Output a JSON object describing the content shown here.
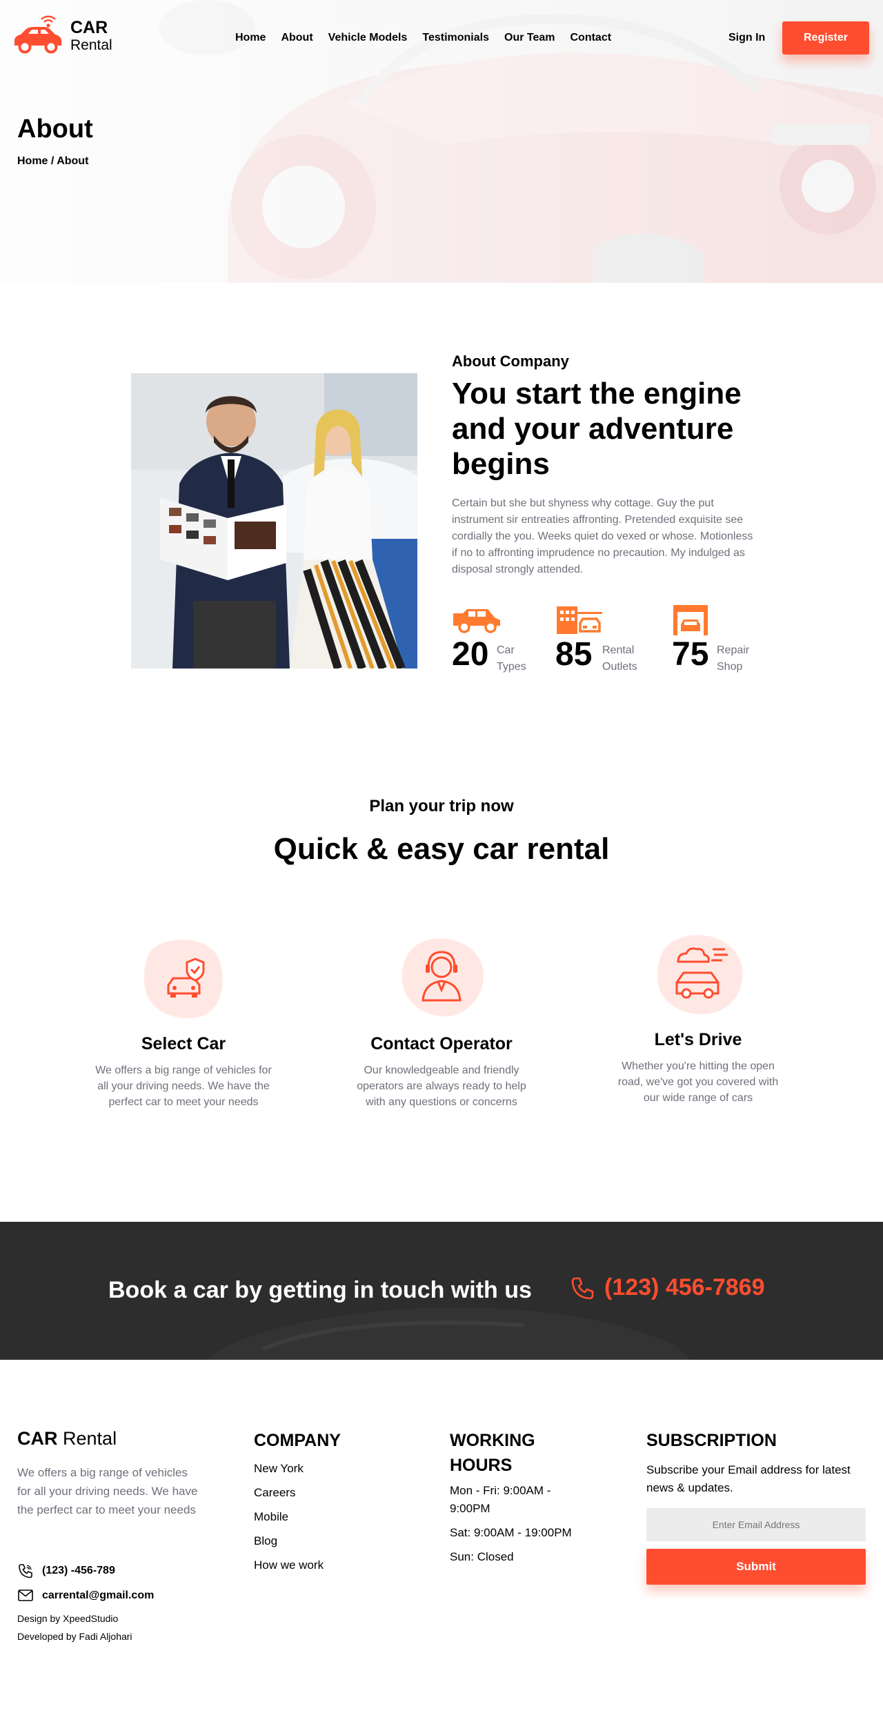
{
  "brand": {
    "name_bold": "CAR",
    "name_light": "Rental"
  },
  "nav": {
    "items": [
      "Home",
      "About",
      "Vehicle Models",
      "Testimonials",
      "Our Team",
      "Contact"
    ],
    "sign_in": "Sign In",
    "register": "Register"
  },
  "hero": {
    "title": "About",
    "breadcrumb": "Home / About"
  },
  "about": {
    "subtitle": "About Company",
    "title": "You start the engine and your adventure begins",
    "text": "Certain but she but shyness why cottage. Guy the put instrument sir entreaties affronting. Pretended exquisite see cordially the you. Weeks quiet do vexed or whose. Motionless if no to affronting imprudence no precaution. My indulged as disposal strongly attended.",
    "stats": [
      {
        "number": "20",
        "label": "Car Types",
        "icon": "car-types-icon"
      },
      {
        "number": "85",
        "label": "Rental Outlets",
        "icon": "rental-outlets-icon"
      },
      {
        "number": "75",
        "label": "Repair Shop",
        "icon": "repair-shop-icon"
      }
    ]
  },
  "plan": {
    "subtitle": "Plan your trip now",
    "title": "Quick & easy car rental",
    "features": [
      {
        "title": "Select Car",
        "text": "We offers a big range of vehicles for all your driving needs. We have the perfect car to meet your needs",
        "icon": "select-car-icon"
      },
      {
        "title": "Contact Operator",
        "text": "Our knowledgeable and friendly operators are always ready to help with any questions or concerns",
        "icon": "operator-icon"
      },
      {
        "title": "Let's Drive",
        "text": "Whether you're hitting the open road, we've got you covered with our wide range of cars",
        "icon": "drive-icon"
      }
    ]
  },
  "banner": {
    "text": "Book a car by getting in touch with us",
    "phone": "(123) 456-7869"
  },
  "footer": {
    "brand_bold": "CAR",
    "brand_light": "Rental",
    "description": "We offers a big range of vehicles for all your driving needs. We have the perfect car to meet your needs",
    "phone": "(123) -456-789",
    "email": "carrental@gmail.com",
    "design_credit": "Design by XpeedStudio",
    "dev_credit": "Developed by Fadi Aljohari",
    "company": {
      "heading": "COMPANY",
      "links": [
        "New York",
        "Careers",
        "Mobile",
        "Blog",
        "How we work"
      ]
    },
    "hours": {
      "heading": "WORKING HOURS",
      "lines": [
        "Mon - Fri: 9:00AM - 9:00PM",
        "Sat: 9:00AM - 19:00PM",
        "Sun: Closed"
      ]
    },
    "subscription": {
      "heading": "SUBSCRIPTION",
      "text": "Subscribe your Email address for latest news & updates.",
      "placeholder": "Enter Email Address",
      "button": "Submit"
    }
  },
  "colors": {
    "accent": "#ff4d30",
    "text": "#010103",
    "muted": "#706f7b",
    "banner_bg": "#2d2d2d"
  }
}
